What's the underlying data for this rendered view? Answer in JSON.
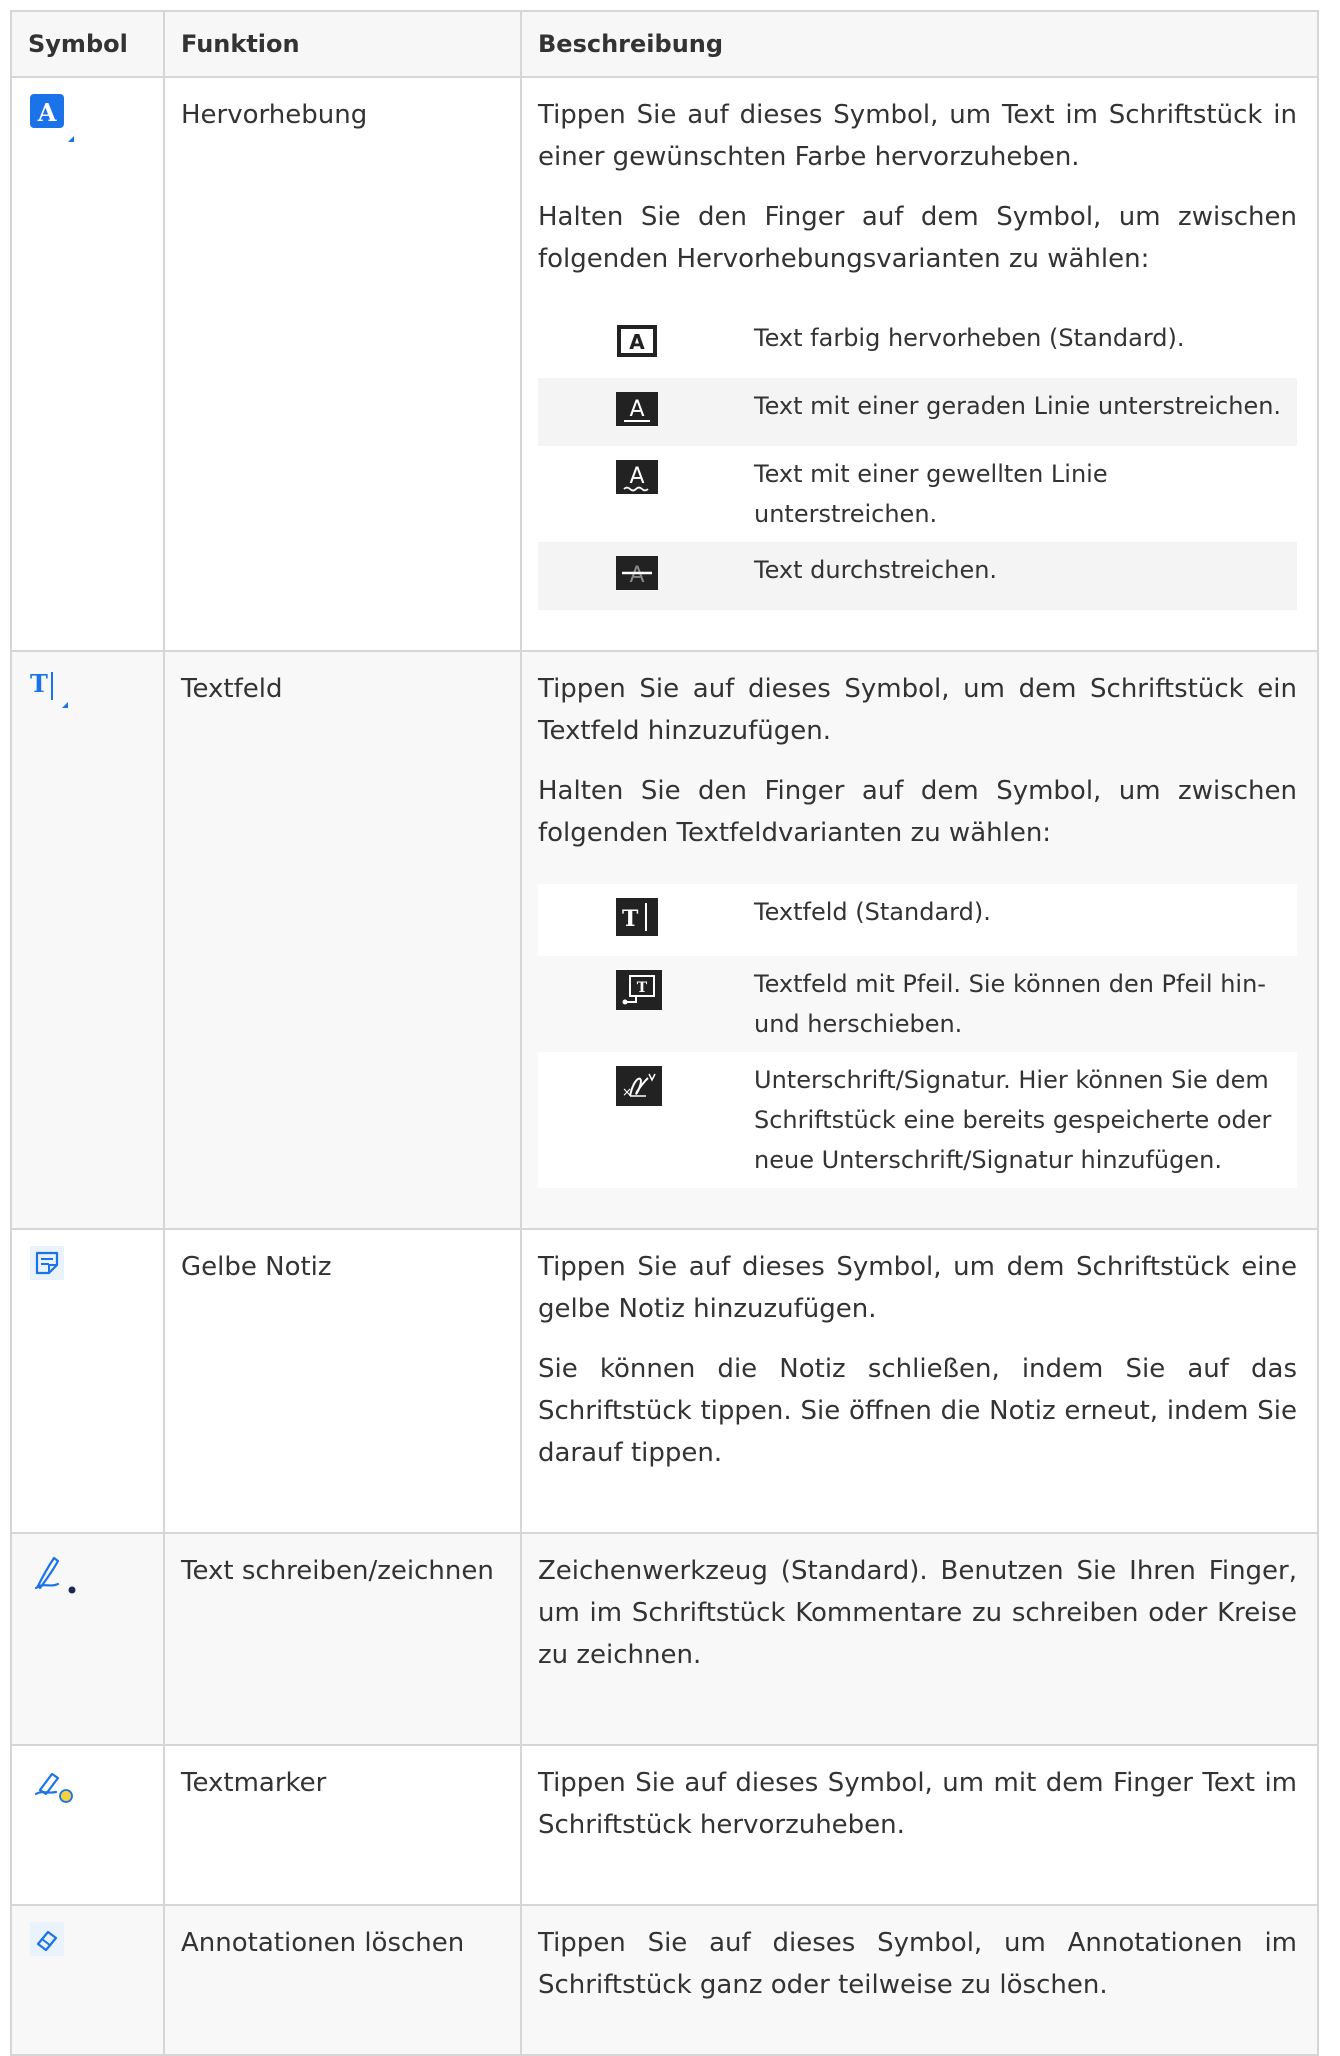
{
  "headers": {
    "symbol": "Symbol",
    "funktion": "Funktion",
    "beschreibung": "Beschreibung"
  },
  "rows": [
    {
      "icon": "highlight-a-icon",
      "function": "Hervorhebung",
      "desc": [
        "Tippen Sie auf dieses Symbol, um Text im Schriftstück in einer gewünschten Farbe hervorzuheben.",
        "Halten Sie den Finger auf dem Symbol, um zwischen folgenden Hervorhebungsvarianten zu wählen:"
      ],
      "options": [
        {
          "icon": "highlight-box-icon",
          "text": "Text farbig hervorheben (Standard)."
        },
        {
          "icon": "underline-straight-icon",
          "text": "Text mit einer geraden Linie unterstreichen."
        },
        {
          "icon": "underline-wavy-icon",
          "text": "Text mit einer gewellten Linie unterstreichen."
        },
        {
          "icon": "strikethrough-icon",
          "text": "Text durchstreichen."
        }
      ]
    },
    {
      "icon": "textfield-icon",
      "function": "Textfeld",
      "desc": [
        "Tippen Sie auf dieses Symbol, um dem Schriftstück ein Textfeld hinzuzufügen.",
        "Halten Sie den Finger auf dem Symbol, um zwischen folgenden Textfeldvarianten zu wählen:"
      ],
      "options": [
        {
          "icon": "textfield-dark-icon",
          "text": "Textfeld (Standard)."
        },
        {
          "icon": "textfield-arrow-icon",
          "text": "Textfeld mit Pfeil. Sie können den Pfeil hin- und herschieben."
        },
        {
          "icon": "signature-icon",
          "text": "Unterschrift/Signatur. Hier können Sie dem Schriftstück eine bereits gespeicherte oder neue Unterschrift/Signatur hinzufügen."
        }
      ]
    },
    {
      "icon": "note-icon",
      "function": "Gelbe Notiz",
      "desc": [
        "Tippen Sie auf dieses Symbol, um dem Schriftstück eine gelbe Notiz hinzuzufügen.",
        "Sie können die Notiz schließen, indem Sie auf das Schriftstück tippen. Sie öffnen die Notiz erneut, indem Sie darauf tippen."
      ]
    },
    {
      "icon": "pen-icon",
      "function": "Text schreiben/zeichnen",
      "desc": [
        "Zeichenwerkzeug (Standard). Benutzen Sie Ihren Finger, um im Schriftstück Kommentare zu schreiben oder Kreise zu zeichnen."
      ]
    },
    {
      "icon": "marker-icon",
      "function": "Textmarker",
      "desc": [
        "Tippen Sie auf dieses Symbol, um mit dem Finger Text im Schriftstück hervorzuheben."
      ]
    },
    {
      "icon": "eraser-icon",
      "function": "Annotationen löschen",
      "desc": [
        "Tippen Sie auf dieses Symbol, um Annotationen im Schriftstück ganz oder teilweise zu löschen."
      ]
    }
  ],
  "colors": {
    "accent_blue": "#1a73e8",
    "dark_icon": "#222222",
    "border": "#d6d6d6"
  }
}
